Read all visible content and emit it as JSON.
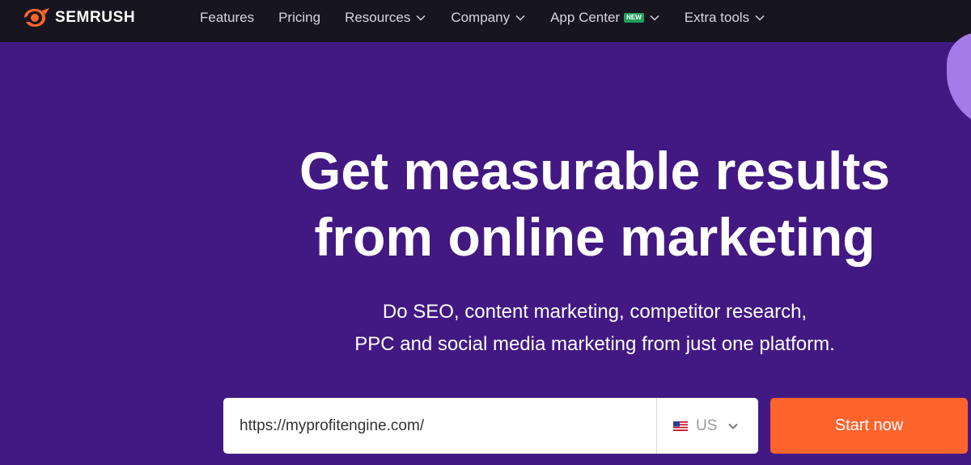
{
  "brand": {
    "name": "SEMRUSH",
    "accent": "#ff642d"
  },
  "nav": {
    "items": [
      {
        "label": "Features",
        "dropdown": false
      },
      {
        "label": "Pricing",
        "dropdown": false
      },
      {
        "label": "Resources",
        "dropdown": true
      },
      {
        "label": "Company",
        "dropdown": true
      },
      {
        "label": "App Center",
        "dropdown": true,
        "badge": "NEW"
      },
      {
        "label": "Extra tools",
        "dropdown": true
      }
    ]
  },
  "hero": {
    "headline_line1": "Get measurable results",
    "headline_line2": "from online marketing",
    "sub_line1": "Do SEO, content marketing, competitor research,",
    "sub_line2": "PPC and social media marketing from just one platform."
  },
  "search": {
    "value": "https://myprofitengine.com/",
    "region": "US",
    "region_icon": "us-flag-icon"
  },
  "cta": {
    "label": "Start now"
  },
  "colors": {
    "background": "#421983",
    "topbar": "#17161f",
    "cta": "#ff642d",
    "badge": "#1fa05a"
  }
}
